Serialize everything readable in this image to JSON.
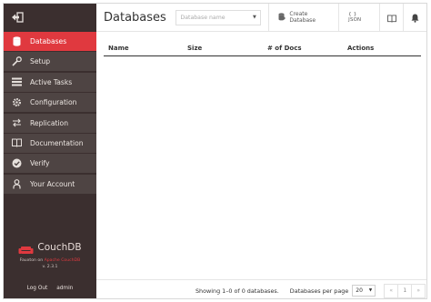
{
  "header": {
    "title": "Databases",
    "db_select_placeholder": "Database name",
    "create_db_label": "Create Database",
    "json_label": "{ } JSON"
  },
  "sidebar": {
    "items": [
      {
        "label": "Databases",
        "icon": "database-icon",
        "active": true
      },
      {
        "label": "Setup",
        "icon": "wrench-icon"
      },
      {
        "label": "Active Tasks",
        "icon": "tasks-icon"
      },
      {
        "label": "Configuration",
        "icon": "gear-icon"
      },
      {
        "label": "Replication",
        "icon": "replication-icon"
      },
      {
        "label": "Documentation",
        "icon": "book-icon"
      },
      {
        "label": "Verify",
        "icon": "check-circle-icon"
      },
      {
        "label": "Your Account",
        "icon": "user-icon"
      }
    ],
    "brand": "CouchDB",
    "fauxton_prefix": "Fauxton on",
    "fauxton_link": "Apache CouchDB",
    "version": "v. 2.3.1",
    "logout": "Log Out",
    "username": "admin"
  },
  "table": {
    "columns": [
      "Name",
      "Size",
      "# of Docs",
      "Actions"
    ]
  },
  "footer": {
    "showing": "Showing 1–0 of 0 databases.",
    "per_page_label": "Databases per page",
    "per_page_value": "20",
    "pager_prev": "«",
    "pager_page": "1",
    "pager_next": "»"
  },
  "colors": {
    "sidebar_bg": "#3b2f2f",
    "nav_item_bg": "#4e4443",
    "accent": "#e0393f"
  }
}
